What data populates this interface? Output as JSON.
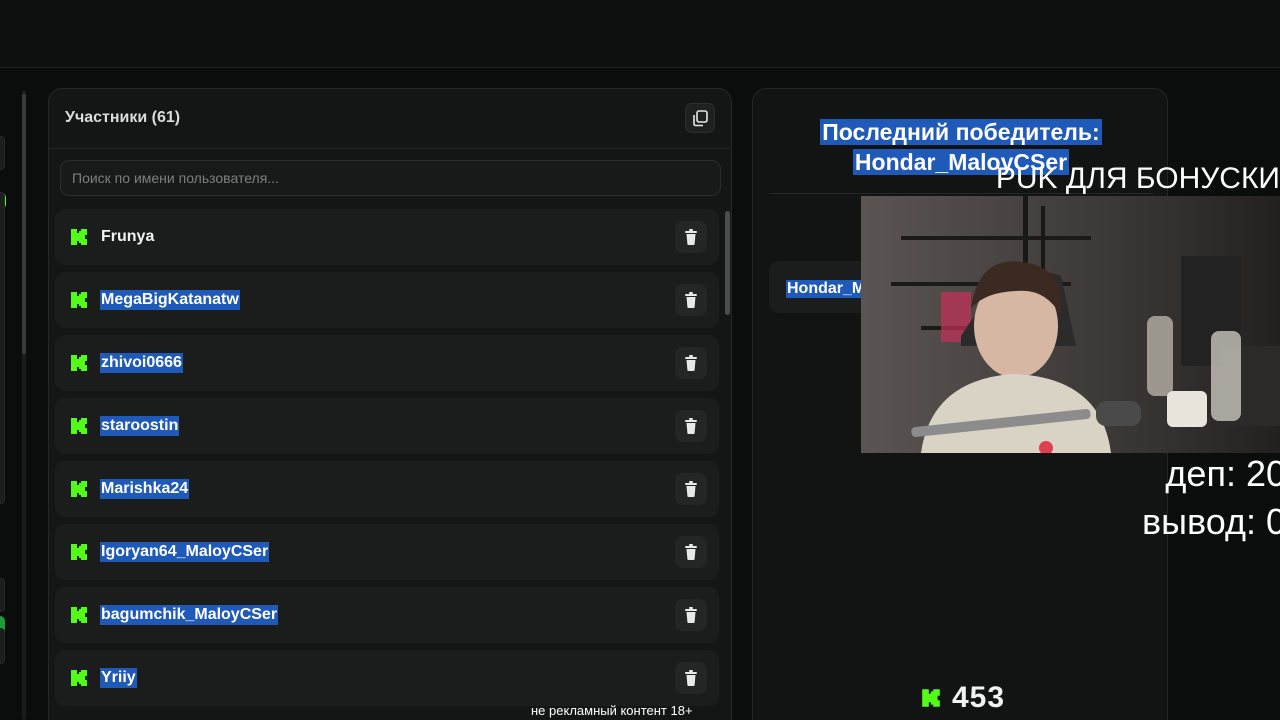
{
  "participants": {
    "title": "Участники (61)",
    "search_placeholder": "Поиск по имени пользователя...",
    "items": [
      {
        "name": "Frunya",
        "selected": false
      },
      {
        "name": "MegaBigKatanatw",
        "selected": true
      },
      {
        "name": "zhivoi0666",
        "selected": true
      },
      {
        "name": "staroostin",
        "selected": true
      },
      {
        "name": "Marishka24",
        "selected": true
      },
      {
        "name": "Igoryan64_MaloyCSer",
        "selected": true
      },
      {
        "name": "bagumchik_MaloyCSer",
        "selected": true
      },
      {
        "name": "Yriiy",
        "selected": true
      }
    ]
  },
  "winner": {
    "title_line1": "Последний победитель:",
    "title_line2": "Hondar_MaloyCSer",
    "chip_text": "Hondar_MaloyCSer"
  },
  "overlay": {
    "promo": "PUK ДЛЯ БОНУСКИ",
    "deposit": "деп: 20",
    "withdraw": "вывод: 0",
    "counter": "453",
    "disclaimer": "не рекламный контент 18+"
  },
  "colors": {
    "accent": "#53fc18",
    "selection": "#1f5ab8",
    "background": "#0b0c0c"
  }
}
